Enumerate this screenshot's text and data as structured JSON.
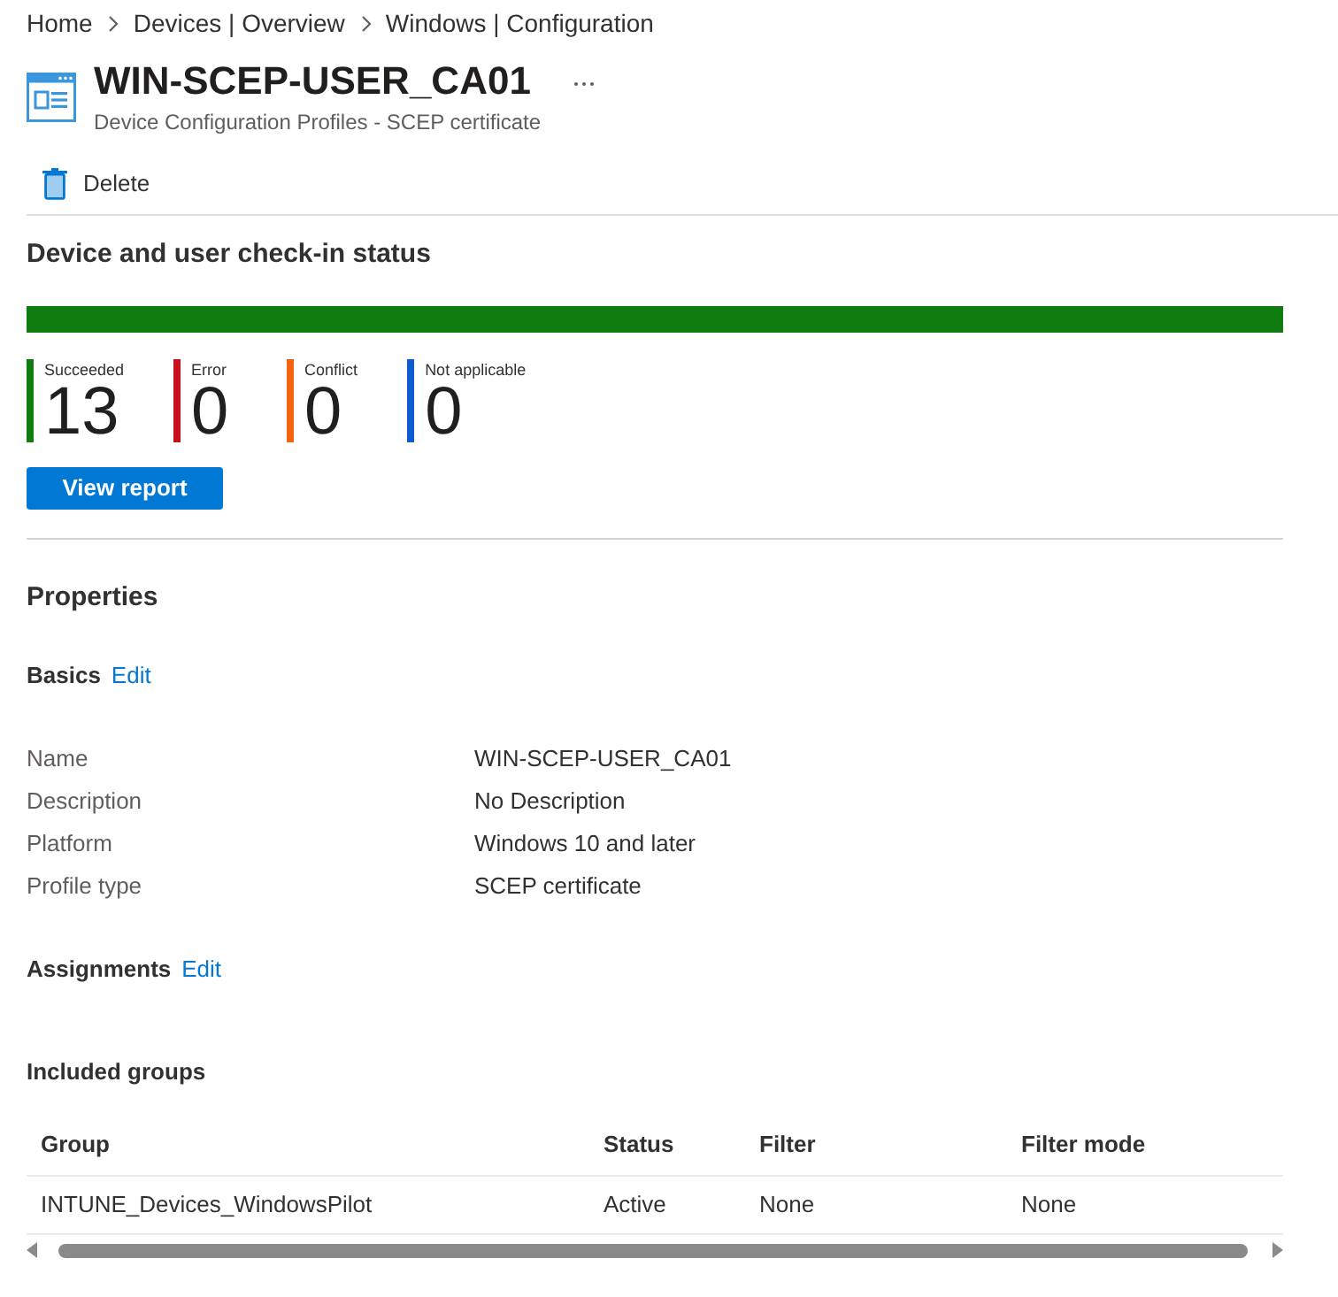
{
  "breadcrumb": [
    "Home",
    "Devices | Overview",
    "Windows | Configuration"
  ],
  "header": {
    "title": "WIN-SCEP-USER_CA01",
    "subtitle": "Device Configuration Profiles - SCEP certificate"
  },
  "toolbar": [
    {
      "label": "Delete"
    }
  ],
  "checkin": {
    "title": "Device and user check-in status",
    "progress": {
      "level": 1
    },
    "stats": [
      {
        "label": "Succeeded",
        "value": "13",
        "color": "#107c10"
      },
      {
        "label": "Error",
        "value": "0",
        "color": "#c50f1f"
      },
      {
        "label": "Conflict",
        "value": "0",
        "color": "#f7630c"
      },
      {
        "label": "Not applicable",
        "value": "0",
        "color": "#0f5cd0"
      }
    ],
    "button": "View report"
  },
  "properties": {
    "title": "Properties",
    "basics": {
      "title": "Basics",
      "edit": "Edit",
      "fields": [
        {
          "label": "Name",
          "value": "WIN-SCEP-USER_CA01"
        },
        {
          "label": "Description",
          "value": "No Description"
        },
        {
          "label": "Platform",
          "value": "Windows 10 and later"
        },
        {
          "label": "Profile type",
          "value": "SCEP certificate"
        }
      ]
    },
    "assignments": {
      "title": "Assignments",
      "edit": "Edit"
    },
    "included_groups": {
      "title": "Included groups",
      "table": {
        "columns": [
          "Group",
          "Status",
          "Filter",
          "Filter mode"
        ],
        "rows": [
          [
            "INTUNE_Devices_WindowsPilot",
            "Active",
            "None",
            "None"
          ]
        ]
      }
    }
  }
}
